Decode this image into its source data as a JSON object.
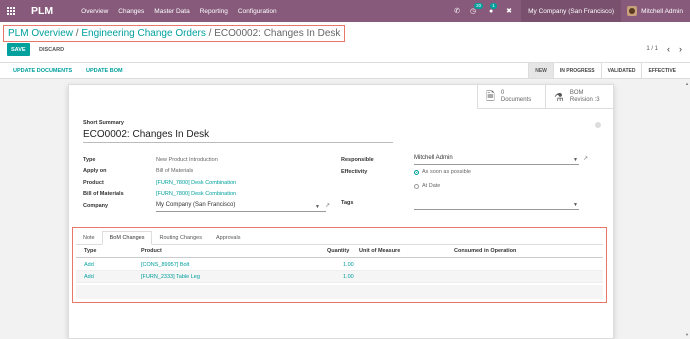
{
  "navbar": {
    "app_title": "PLM",
    "menu": [
      "Overview",
      "Changes",
      "Master Data",
      "Reporting",
      "Configuration"
    ],
    "messages_count": "20",
    "activity_count": "1",
    "company": "My Company (San Francisco)",
    "user": "Mitchell Admin",
    "colors": {
      "bar": "#875a7b",
      "accent": "#00a09d"
    }
  },
  "breadcrumb": {
    "items": [
      "PLM Overview",
      "Engineering Change Orders"
    ],
    "separator": "/",
    "current": "ECO0002: Changes In Desk"
  },
  "actions": {
    "save": "SAVE",
    "discard": "DISCARD"
  },
  "pager": {
    "value": "1 / 1"
  },
  "statusbar": {
    "buttons": [
      "UPDATE DOCUMENTS",
      "UPDATE BOM"
    ],
    "stages": [
      "NEW",
      "IN PROGRESS",
      "VALIDATED",
      "EFFECTIVE"
    ],
    "active_stage": "NEW"
  },
  "smart_buttons": {
    "documents": {
      "count": "0",
      "label": "Documents"
    },
    "bom": {
      "label": "BOM",
      "sub": "Revision :3"
    }
  },
  "form": {
    "summary_label": "Short Summary",
    "summary": "ECO0002: Changes In Desk",
    "type_label": "Type",
    "type": "New Product Introduction",
    "apply_on_label": "Apply on",
    "apply_on": "Bill of Materials",
    "product_label": "Product",
    "product": "[FURN_7800] Desk Combination",
    "bom_label": "Bill of Materials",
    "bom": "[FURN_7800] Desk Combination",
    "company_label": "Company",
    "company": "My Company (San Francisco)",
    "responsible_label": "Responsible",
    "responsible": "Mitchell Admin",
    "effectivity_label": "Effectivity",
    "effectivity_options": [
      "As soon as possible",
      "At Date"
    ],
    "effectivity_selected": "As soon as possible",
    "tags_label": "Tags"
  },
  "notebook": {
    "tabs": [
      "Note",
      "BoM Changes",
      "Routing Changes",
      "Approvals"
    ],
    "active_tab": "BoM Changes",
    "columns": [
      "Type",
      "Product",
      "Quantity",
      "Unit of Measure",
      "Consumed in Operation"
    ],
    "rows": [
      {
        "type": "Add",
        "product": "[CONS_89957] Bolt",
        "quantity": "1.00"
      },
      {
        "type": "Add",
        "product": "[FURN_2333] Table Leg",
        "quantity": "1.00"
      }
    ]
  }
}
